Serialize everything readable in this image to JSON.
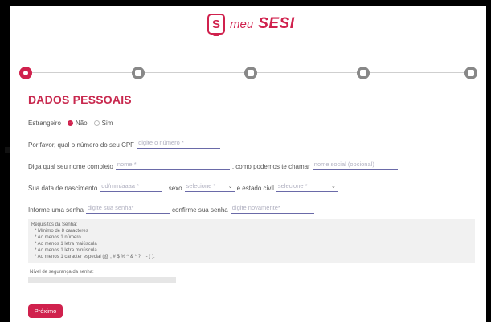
{
  "brand": {
    "icon_letter": "S",
    "meu": "meu",
    "sesi": "SESI"
  },
  "stepper": {
    "steps": [
      "person-icon",
      "phone-icon",
      "mail-icon",
      "folder-icon",
      "flag-icon"
    ]
  },
  "section_title": "DADOS PESSOAIS",
  "estrangeiro": {
    "label": "Estrangeiro",
    "option_no": "Não",
    "option_yes": "Sim",
    "selected": "Não"
  },
  "cpf": {
    "label": "Por favor, qual o número do seu CPF",
    "placeholder": "digite o número *"
  },
  "name": {
    "label": "Diga qual seu nome completo",
    "placeholder": "nome *",
    "social_label": ", como podemos te chamar",
    "social_placeholder": "nome social (opcional)"
  },
  "birth": {
    "label": "Sua data de nascimento",
    "placeholder": "dd/mm/aaaa *",
    "sexo_label": ", sexo",
    "sexo_value": "selecione *",
    "civil_label": "e estado civil",
    "civil_value": "selecione *"
  },
  "password": {
    "label": "Informe uma senha",
    "placeholder": "digite sua senha*",
    "confirm_label": "confirme sua senha",
    "confirm_placeholder": "digite novamente*"
  },
  "requirements": {
    "title": "Requisitos da Senha:",
    "items": [
      "* Mínimo de 8 caracteres",
      "* Ao menos 1 número",
      "* Ao menos 1 letra maiúscula",
      "* Ao menos 1 letra minúscula",
      "* Ao menos 1 caracter especial (@ , # $ % ^ & * ? _ - ( )."
    ]
  },
  "strength": {
    "label": "Nível de segurança da senha:"
  },
  "next_button": "Próximo"
}
